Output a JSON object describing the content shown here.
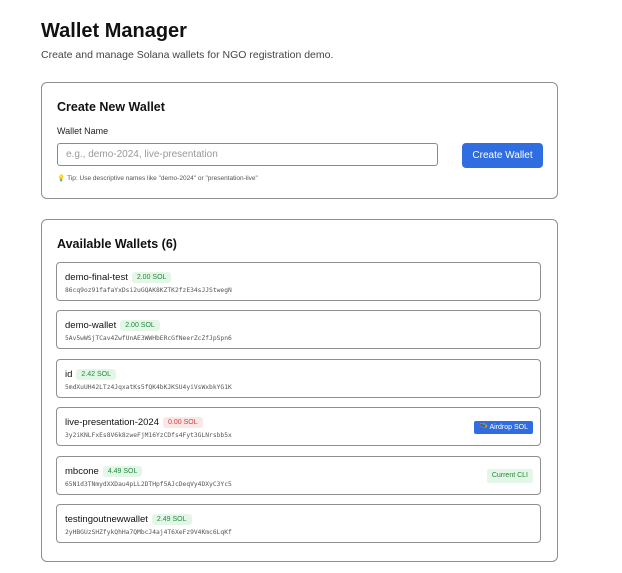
{
  "header": {
    "title": "Wallet Manager",
    "subtitle": "Create and manage Solana wallets for NGO registration demo."
  },
  "create": {
    "title": "Create New Wallet",
    "label": "Wallet Name",
    "placeholder": "e.g., demo-2024, live-presentation",
    "value": "",
    "button": "Create Wallet",
    "tip_icon": "💡",
    "tip": "Tip: Use descriptive names like \"demo-2024\" or \"presentation-live\""
  },
  "wallets": {
    "title": "Available Wallets (6)",
    "items": [
      {
        "name": "demo-final-test",
        "balance": "2.00 SOL",
        "address": "86cq9oz91fafaYxDsi2uGQAK8KZTK2fzE34sJJStwegN"
      },
      {
        "name": "demo-wallet",
        "balance": "2.00 SOL",
        "address": "5Av5wWSjTCav4ZwfUnAE3WWHbERcGfNeerZcZfJpSpn6"
      },
      {
        "name": "id",
        "balance": "2.42 SOL",
        "address": "5mdXuUH42LTz4JqxatKs5fQK4bKJKSU4yiVsWxbkYG1K"
      },
      {
        "name": "live-presentation-2024",
        "balance": "0.00 SOL",
        "address": "3y2iKNLFxEs8V6k8zweFjM16YzCDfs4Fyt3GLNrsbb5x",
        "action": "🪂 Airdrop SOL"
      },
      {
        "name": "mbcone",
        "balance": "4.49 SOL",
        "address": "65N1d3TNmydXXDau4pLL2DTHpf5AJcDeqVy4DXyC3Yc5",
        "status": "Current CLI"
      },
      {
        "name": "testingoutnewwallet",
        "balance": "2.49 SOL",
        "address": "2yHBGUzSHZfykQhHa7QMbcJ4aj4T6XeFz9V4Kmc6LqKf"
      }
    ]
  },
  "colors": {
    "primary": "#2f6de1",
    "positive_text": "#218a3a",
    "positive_bg": "#e3f6e7",
    "negative_text": "#d23c3c",
    "negative_bg": "#fde6e6"
  }
}
